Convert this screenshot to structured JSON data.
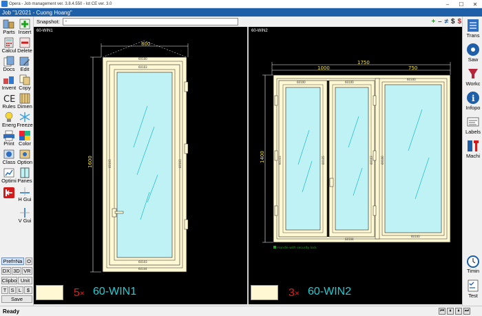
{
  "window": {
    "title": "Opera - Job management ver. 3.8.4.550 - lot CE ver. 3.0",
    "controls": [
      "–",
      "☐",
      "✕"
    ]
  },
  "job": {
    "title": "Job \"1/2021 - Cuong Hoang\""
  },
  "left_toolbar": {
    "tools": [
      {
        "label": "Parts",
        "icon": "parts-icon"
      },
      {
        "label": "Insert",
        "icon": "insert-icon"
      },
      {
        "label": "Calcul",
        "icon": "calculator-icon"
      },
      {
        "label": "Delete",
        "icon": "delete-icon"
      },
      {
        "label": "Docs",
        "icon": "docs-icon"
      },
      {
        "label": "Edit",
        "icon": "edit-icon"
      },
      {
        "label": "Invent",
        "icon": "inventory-icon"
      },
      {
        "label": "Copy",
        "icon": "copy-icon"
      },
      {
        "label": "Rules",
        "icon": "ce-rules-icon"
      },
      {
        "label": "Dimen",
        "icon": "dimension-icon"
      },
      {
        "label": "Energ",
        "icon": "energy-icon"
      },
      {
        "label": "Freeze",
        "icon": "snowflake-icon"
      },
      {
        "label": "Print",
        "icon": "printer-icon"
      },
      {
        "label": "Color",
        "icon": "color-icon"
      },
      {
        "label": "Class",
        "icon": "class-icon"
      },
      {
        "label": "Option",
        "icon": "option-icon"
      },
      {
        "label": "Optimi",
        "icon": "optimize-icon"
      },
      {
        "label": "Panes",
        "icon": "panes-icon"
      },
      {
        "label": "",
        "icon": "exit-icon"
      },
      {
        "label": "H Gui",
        "icon": "horizontal-guide-icon"
      },
      {
        "label": "V Gui",
        "icon": "vertical-guide-icon"
      }
    ],
    "buttons": {
      "pref": "Pref=Na",
      "o": "O",
      "dx": "DX",
      "d3": "3D",
      "vr": "VR",
      "clipbo": "Clipbo",
      "unit": "Unit",
      "t": "T",
      "s": "S",
      "l": "L",
      "dollar": "$",
      "save": "Save"
    }
  },
  "snapshot": {
    "label": "Snapshot:",
    "value": "-",
    "buttons": [
      "+",
      "–",
      "≠",
      "$",
      "$"
    ]
  },
  "panels": [
    {
      "title": "60-WIN1",
      "quantity": "5",
      "x": "×",
      "name": "60-WIN1",
      "dims": {
        "width": "800",
        "height": "1600"
      }
    },
    {
      "title": "60-WIN2",
      "quantity": "3",
      "x": "×",
      "name": "60-WIN2",
      "dims": {
        "width_total": "1750",
        "width_left": "1000",
        "width_right": "750",
        "height": "1400"
      },
      "note": "Handle with security lock"
    }
  ],
  "profile_labels": {
    "a": "60100",
    "b": "60104",
    "c": "60103",
    "d": "60105"
  },
  "right_toolbar": {
    "tools": [
      {
        "label": "Trans",
        "icon": "transfer-icon"
      },
      {
        "label": "Saw",
        "icon": "saw-blade-icon"
      },
      {
        "label": "Workc",
        "icon": "workcenter-icon"
      },
      {
        "label": "Infopo",
        "icon": "info-icon"
      },
      {
        "label": "Labels",
        "icon": "labels-icon"
      },
      {
        "label": "Machi",
        "icon": "machine-icon"
      },
      {
        "label": "Timin",
        "icon": "timer-icon"
      },
      {
        "label": "Test",
        "icon": "test-icon"
      }
    ]
  },
  "status": {
    "text": "Ready",
    "controls": [
      "⏮",
      "⏸",
      "⏸",
      "⏭"
    ]
  },
  "colors": {
    "job_bar": "#1e5fa8",
    "frame_fill": "#fff8d2",
    "glass": "#bff2f4",
    "quantity": "#e0201c",
    "window_name": "#19d0d6"
  }
}
